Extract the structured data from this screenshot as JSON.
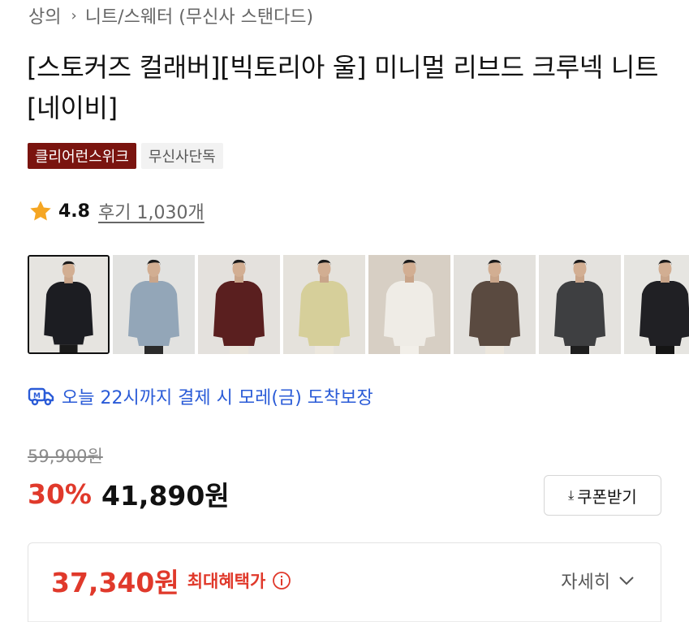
{
  "breadcrumb": {
    "category": "상의",
    "subcategory": "니트/스웨터 (무신사 스탠다드)"
  },
  "product": {
    "title": "[스토커즈 컬래버][빅토리아 울] 미니멀 리브드 크루넥 니트 [네이비]",
    "tags": {
      "brand": "클리어런스위크",
      "exclusive": "무신사단독"
    },
    "rating": "4.8",
    "reviews": "후기 1,030개"
  },
  "gallery": {
    "thumbnails": [
      {
        "color": "navy",
        "sweater": "#1c1d22",
        "bg": "#e6e4e0",
        "pants": "#1a1a1a"
      },
      {
        "color": "light-blue",
        "sweater": "#93a6b8",
        "bg": "#e2e2e0",
        "pants": "#2b2b2b"
      },
      {
        "color": "burgundy",
        "sweater": "#5a1f1f",
        "bg": "#e4e1dd",
        "pants": "#e9e4da"
      },
      {
        "color": "butter",
        "sweater": "#d6cf9a",
        "bg": "#e5e2dc",
        "pants": "#ece7dd"
      },
      {
        "color": "white",
        "sweater": "#efece6",
        "bg": "#d7cfc4",
        "pants": "#f2efe9"
      },
      {
        "color": "brown",
        "sweater": "#5a4a40",
        "bg": "#e3e1dd",
        "pants": "#ece6dc"
      },
      {
        "color": "charcoal",
        "sweater": "#3e3f41",
        "bg": "#e4e2de",
        "pants": "#1e1e1e"
      },
      {
        "color": "black",
        "sweater": "#202024",
        "bg": "#e6e5e1",
        "pants": "#151515"
      }
    ]
  },
  "delivery": {
    "text": "오늘 22시까지 결제 시 모레(금) 도착보장",
    "color": "#2a5bd7"
  },
  "pricing": {
    "original": "59,900원",
    "discount": "30%",
    "sale": "41,890원",
    "coupon_label": "쿠폰받기",
    "accent_color": "#e0392b"
  },
  "benefit": {
    "price": "37,340원",
    "label": "최대혜택가",
    "detail_label": "자세히"
  }
}
